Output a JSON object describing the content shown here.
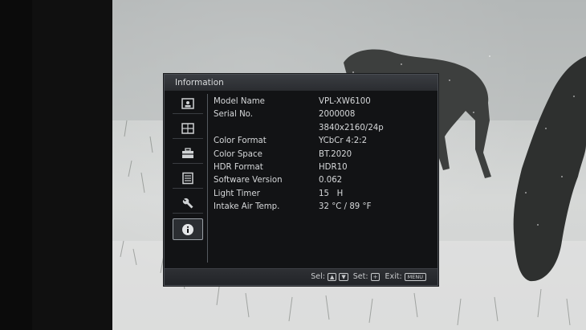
{
  "window": {
    "title": "Information"
  },
  "sidebar": {
    "items": [
      {
        "icon": "picture-icon",
        "active": false
      },
      {
        "icon": "screen-icon",
        "active": false
      },
      {
        "icon": "toolbox-icon",
        "active": false
      },
      {
        "icon": "list-icon",
        "active": false
      },
      {
        "icon": "wrench-icon",
        "active": false
      },
      {
        "icon": "info-icon",
        "active": true
      }
    ]
  },
  "info": {
    "rows": [
      {
        "label": "Model Name",
        "value": "VPL-XW6100"
      },
      {
        "label": "Serial No.",
        "value": "2000008"
      },
      {
        "label": "",
        "value": "3840x2160/24p"
      },
      {
        "label": "Color Format",
        "value": "YCbCr 4:2:2"
      },
      {
        "label": "Color Space",
        "value": "BT.2020"
      },
      {
        "label": "HDR Format",
        "value": "HDR10"
      },
      {
        "label": "Software Version",
        "value": "0.062"
      },
      {
        "label": "Light Timer",
        "value": "15   H"
      },
      {
        "label": "Intake Air Temp.",
        "value": "32 °C / 89 °F"
      }
    ]
  },
  "footer": {
    "sel": "Sel:",
    "set": "Set:",
    "exit": "Exit:",
    "menu_key": "MENU"
  },
  "colors": {
    "osd_bg": "#121315",
    "title_bar": "#3a3d42",
    "text": "#d6d8da"
  }
}
